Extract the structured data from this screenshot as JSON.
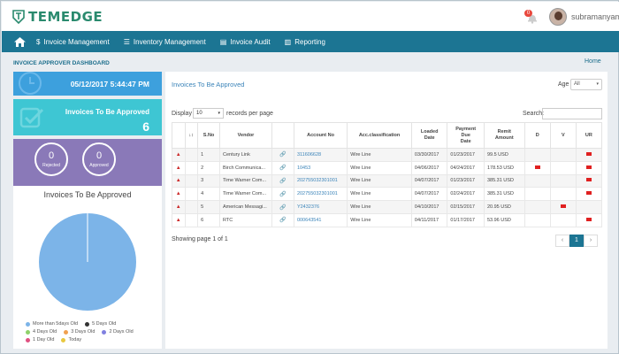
{
  "brand": {
    "name": "TEMEDGE"
  },
  "header": {
    "username": "subramanyam",
    "notification_count": "0"
  },
  "nav": {
    "items": [
      {
        "icon": "dollar-icon",
        "label": "Invoice Management"
      },
      {
        "icon": "list-icon",
        "label": "Inventory Management"
      },
      {
        "icon": "document-icon",
        "label": "Invoice Audit"
      },
      {
        "icon": "bar-chart-icon",
        "label": "Reporting"
      }
    ]
  },
  "page": {
    "title": "INVOICE APPROVER DASHBOARD",
    "home_link": "Home"
  },
  "widgets": {
    "datetime": "05/12/2017 5:44:47 PM",
    "approve_label": "Invoices To Be Approved",
    "approve_count": "6",
    "rejected": {
      "value": "0",
      "label": "Rejected"
    },
    "approved": {
      "value": "0",
      "label": "Approved"
    }
  },
  "pie": {
    "title": "Invoices To Be Approved",
    "legend": [
      {
        "label": "More than 5days Old",
        "color": "#7cb4e8"
      },
      {
        "label": "5 Days Old",
        "color": "#333333"
      },
      {
        "label": "4 Days Old",
        "color": "#8fd16a"
      },
      {
        "label": "3 Days Old",
        "color": "#f0a050"
      },
      {
        "label": "2 Days Old",
        "color": "#8080e0"
      },
      {
        "label": "1 Day Old",
        "color": "#e05080"
      },
      {
        "label": "Today",
        "color": "#e8c840"
      }
    ]
  },
  "chart_data": {
    "type": "pie",
    "title": "Invoices To Be Approved",
    "slices": [
      {
        "label": "More than 5days Old",
        "value": 6
      },
      {
        "label": "5 Days Old",
        "value": 0
      },
      {
        "label": "4 Days Old",
        "value": 0
      },
      {
        "label": "3 Days Old",
        "value": 0
      },
      {
        "label": "2 Days Old",
        "value": 0
      },
      {
        "label": "1 Day Old",
        "value": 0
      },
      {
        "label": "Today",
        "value": 0
      }
    ]
  },
  "table_panel": {
    "title": "Invoices To Be Approved",
    "age_label": "Age",
    "age_value": "All",
    "display_label": "Display",
    "display_value": "10",
    "records_label": "records per page",
    "search_label": "Search:",
    "showing": "Showing page 1 of 1",
    "pager": {
      "prev": "‹",
      "page": "1",
      "next": "›"
    },
    "sort_icon": "↓↕",
    "columns": [
      "S.No",
      "Vendor",
      "Account No",
      "Acc.classification",
      "Loaded\nDate",
      "Payment\nDue\nDate",
      "Remit\nAmount",
      "D",
      "V",
      "UR"
    ],
    "rows": [
      {
        "sno": "1",
        "vendor": "Century Link",
        "account": "311606628",
        "cls": "Wire Line",
        "loaded": "03/30/2017",
        "due": "01/23/2017",
        "amount": "99.5 USD",
        "d": false,
        "v": false,
        "ur": true
      },
      {
        "sno": "2",
        "vendor": "Birch Communica...",
        "account": "10453",
        "cls": "Wire Line",
        "loaded": "04/06/2017",
        "due": "04/24/2017",
        "amount": "178.53 USD",
        "d": true,
        "v": false,
        "ur": true
      },
      {
        "sno": "3",
        "vendor": "Time Warner Com...",
        "account": "202755032301001",
        "cls": "Wire Line",
        "loaded": "04/07/2017",
        "due": "01/23/2017",
        "amount": "385.31 USD",
        "d": false,
        "v": false,
        "ur": true
      },
      {
        "sno": "4",
        "vendor": "Time Warner Com...",
        "account": "202755032301001",
        "cls": "Wire Line",
        "loaded": "04/07/2017",
        "due": "02/24/2017",
        "amount": "385.31 USD",
        "d": false,
        "v": false,
        "ur": true
      },
      {
        "sno": "5",
        "vendor": "American Messagi...",
        "account": "Y2432376",
        "cls": "Wire Line",
        "loaded": "04/10/2017",
        "due": "02/15/2017",
        "amount": "20.95 USD",
        "d": false,
        "v": true,
        "ur": false
      },
      {
        "sno": "6",
        "vendor": "RTC",
        "account": "000643541",
        "cls": "Wire Line",
        "loaded": "04/11/2017",
        "due": "01/17/2017",
        "amount": "53.96 USD",
        "d": false,
        "v": false,
        "ur": true
      }
    ]
  }
}
